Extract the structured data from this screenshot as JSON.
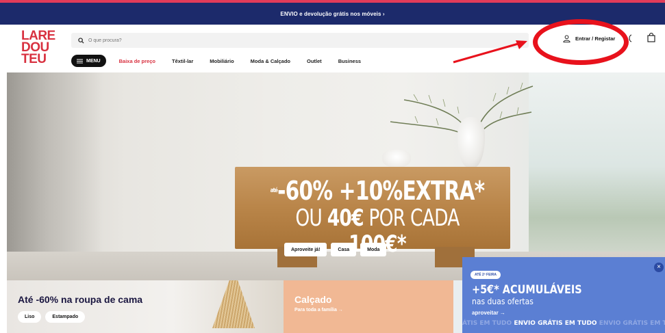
{
  "promo_bar": {
    "text": "ENVIO e devolução grátis nos móveis ›"
  },
  "header": {
    "logo": {
      "line1": "LARE",
      "line2": "DOU",
      "line3": "TEU"
    },
    "search": {
      "placeholder": "O que procura?",
      "value": ""
    },
    "account_label": "Entrar / Registar",
    "menu_label": "MENU",
    "nav": [
      "Baixa de preço",
      "Têxtil-lar",
      "Mobiliário",
      "Moda & Calçado",
      "Outlet",
      "Business"
    ]
  },
  "hero": {
    "line1_small": "até",
    "line1": "-60% +10%EXTRA*",
    "line2_prefix": "OU ",
    "line2_bold1": "40€",
    "line2_mid": " POR CADA ",
    "line2_bold2": "100€*",
    "buttons": [
      "Aproveite já!",
      "Casa",
      "Moda"
    ]
  },
  "cards": {
    "bedding": {
      "title": "Até -60% na roupa de cama",
      "pills": [
        "Liso",
        "Estampado"
      ]
    },
    "footwear": {
      "title": "Calçado",
      "subtitle": "Para toda a família →"
    }
  },
  "popup": {
    "badge": "ATÉ 2ª FEIRA",
    "title": "+5€* ACUMULÁVEIS",
    "subtitle": "nas duas ofertas",
    "link": "aproveitar →",
    "ticker_ghost": "ÁTIS EM TUDO ",
    "ticker_main": "ENVIO GRÁTIS EM TUDO ",
    "ticker_ghost2": "ENVIO GRÁTIS EM TUD",
    "close": "×"
  },
  "colors": {
    "brand_red": "#d8303f",
    "promo_blue": "#1c2a6b",
    "annotation_red": "#e8121c",
    "popup_blue": "#5b7fd3"
  }
}
